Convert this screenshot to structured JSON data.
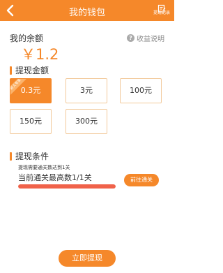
{
  "header": {
    "title": "我的钱包",
    "record_label": "提现记录",
    "back_icon": "back-arrow-icon",
    "record_icon": "edit-document-icon",
    "background": "#f5882a"
  },
  "balance": {
    "label": "我的余额",
    "value": "￥1.2",
    "help_label": "收益说明",
    "help_icon": "question-icon"
  },
  "withdraw_amount": {
    "title": "提现金额",
    "badge": "新人专享",
    "options": [
      "0.3元",
      "3元",
      "100元",
      "150元",
      "300元"
    ],
    "selected": "0.3元"
  },
  "conditions": {
    "title": "提现条件",
    "requirement": "提现需要通关数达到1关",
    "current": "当前通关最高数1/1关",
    "progress": 1.0,
    "goto_label": "前往通关"
  },
  "actions": {
    "withdraw_label": "立即提现"
  },
  "colors": {
    "accent": "#f5882a",
    "progress": "#f0624a",
    "option_border": "#f2c99a"
  }
}
